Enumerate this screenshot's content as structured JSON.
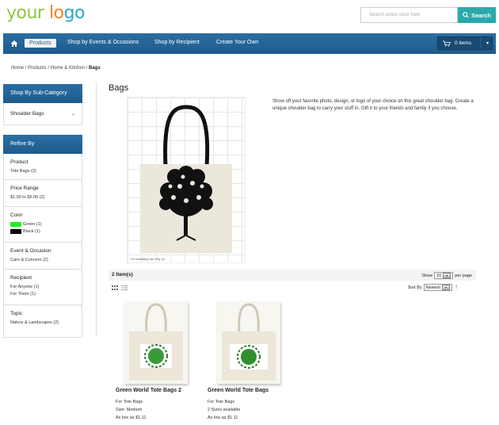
{
  "logo": {
    "part1": "your",
    "part2": "lo",
    "part3": "go"
  },
  "search": {
    "placeholder": "Search entire store here",
    "button": "Search"
  },
  "nav": {
    "items": [
      "Products",
      "Shop by Events & Occasions",
      "Shop by Recipient",
      "Create Your Own"
    ],
    "cart": "0 items"
  },
  "breadcrumb": {
    "path": "Home / Products / Home & Kitchen / ",
    "current": "Bags"
  },
  "sidebar": {
    "subcategory_title": "Shop By Sub-Category",
    "subcategory_value": "Shoulder Bags",
    "refine_title": "Refine By",
    "groups": [
      {
        "title": "Product",
        "options": [
          "Tote Bags (2)"
        ]
      },
      {
        "title": "Price Range",
        "options": [
          "$1.00 to $5.00 (2)"
        ]
      },
      {
        "title": "Color",
        "options": [
          "Green (1)",
          "Black (1)"
        ]
      },
      {
        "title": "Event & Occasion",
        "options": [
          "Care & Concern (2)"
        ]
      },
      {
        "title": "Recipient",
        "options": [
          "For Anyone (1)",
          "For Them (1)"
        ]
      },
      {
        "title": "Topic",
        "options": [
          "Nature & Landscapes (2)"
        ]
      }
    ],
    "colors": {
      "green": "#22ee22",
      "black": "#000000"
    }
  },
  "main": {
    "title": "Bags",
    "description": "Show off your favorite photo, design, or logo of your choice on this great shoulder bag. Create a unique shoulder bag to carry your stuff in. Gift it to your friends and family if you choose.",
    "hero_caption": "For Illustrating Use Only. (c)",
    "item_count": "2 Item(s)",
    "show_label": "Show",
    "show_value": "20",
    "per_page": "per page",
    "sort_label": "Sort By",
    "sort_value": "Newest"
  },
  "products": [
    {
      "name": "Green World Tote Bags 2",
      "type": "For Tote Bags",
      "size": "Size: Medium",
      "price": "As low as $1.11"
    },
    {
      "name": "Green World Tote Bags",
      "type": "For Tote Bags",
      "size": "2 Sizes available",
      "price": "As low as $1.11"
    }
  ],
  "theme": {
    "nav_blue": "#1f5b8c",
    "search_teal": "#2aa9a9"
  }
}
